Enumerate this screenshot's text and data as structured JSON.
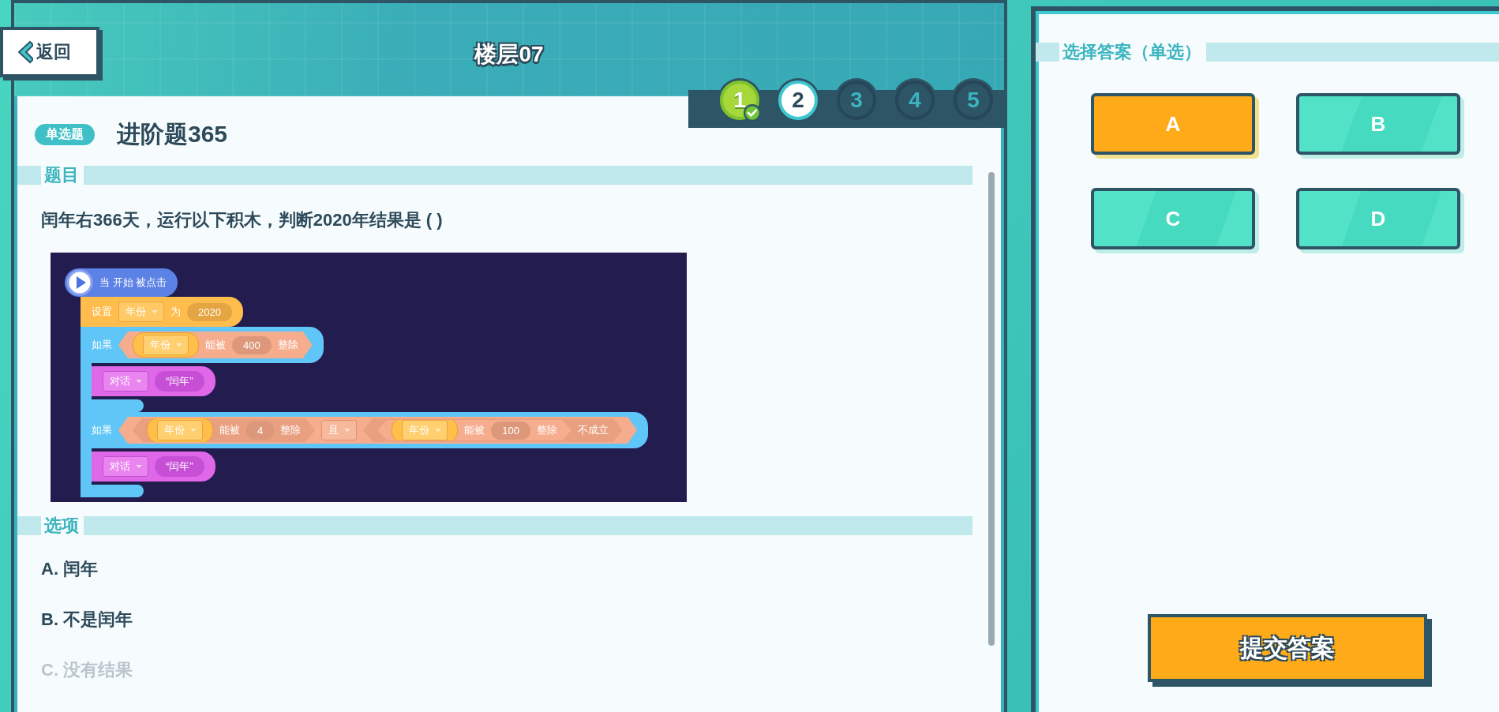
{
  "header": {
    "back_button": "返回",
    "title": "楼层07"
  },
  "question_steps": [
    {
      "label": "1",
      "done": true,
      "selected": false
    },
    {
      "label": "2",
      "done": false,
      "selected": true
    },
    {
      "label": "3",
      "done": false,
      "selected": false
    },
    {
      "label": "4",
      "done": false,
      "selected": false
    },
    {
      "label": "5",
      "done": false,
      "selected": false
    }
  ],
  "question": {
    "type_badge": "单选题",
    "title": "进阶题365",
    "stem_heading": "题目",
    "stem": "闰年右366天，运行以下积木，判断2020年结果是 ( )",
    "code_script": [
      {
        "kind": "event_hat",
        "parts": [
          {
            "kind": "text",
            "text": "当 开始 被点击"
          }
        ]
      },
      {
        "kind": "set_variable",
        "parts": [
          {
            "kind": "text",
            "text": "设置"
          },
          {
            "kind": "dropdown",
            "text": "年份"
          },
          {
            "kind": "text",
            "text": "为"
          },
          {
            "kind": "slot",
            "text": "2020"
          }
        ]
      },
      {
        "kind": "if",
        "parts": [
          {
            "kind": "text",
            "text": "如果"
          },
          {
            "kind": "condition",
            "parts": [
              {
                "kind": "reporter",
                "parts": [
                  {
                    "kind": "dropdown",
                    "text": "年份"
                  }
                ]
              },
              {
                "kind": "text",
                "text": "能被"
              },
              {
                "kind": "slot",
                "text": "400"
              },
              {
                "kind": "text",
                "text": "整除"
              }
            ]
          }
        ],
        "body": [
          {
            "kind": "say",
            "parts": [
              {
                "kind": "dropdown",
                "text": "对话"
              },
              {
                "kind": "slot",
                "text": "“闰年”"
              }
            ]
          }
        ]
      },
      {
        "kind": "if",
        "parts": [
          {
            "kind": "text",
            "text": "如果"
          },
          {
            "kind": "condition",
            "parts": [
              {
                "kind": "condition",
                "parts": [
                  {
                    "kind": "reporter",
                    "parts": [
                      {
                        "kind": "dropdown",
                        "text": "年份"
                      }
                    ]
                  },
                  {
                    "kind": "text",
                    "text": "能被"
                  },
                  {
                    "kind": "slot",
                    "text": "4"
                  },
                  {
                    "kind": "text",
                    "text": "整除"
                  }
                ]
              },
              {
                "kind": "dropdown",
                "text": "且"
              },
              {
                "kind": "condition",
                "parts": [
                  {
                    "kind": "condition",
                    "parts": [
                      {
                        "kind": "reporter",
                        "parts": [
                          {
                            "kind": "dropdown",
                            "text": "年份"
                          }
                        ]
                      },
                      {
                        "kind": "text",
                        "text": "能被"
                      },
                      {
                        "kind": "slot",
                        "text": "100"
                      },
                      {
                        "kind": "text",
                        "text": "整除"
                      }
                    ]
                  },
                  {
                    "kind": "text",
                    "text": "不成立"
                  }
                ]
              }
            ]
          }
        ],
        "body": [
          {
            "kind": "say",
            "parts": [
              {
                "kind": "dropdown",
                "text": "对话"
              },
              {
                "kind": "slot",
                "text": "“闰年”"
              }
            ]
          }
        ]
      }
    ],
    "options_heading": "选项",
    "options": [
      "A. 闰年",
      "B. 不是闰年",
      "C. 没有结果"
    ]
  },
  "answer_panel": {
    "heading": "选择答案（单选）",
    "choices": [
      {
        "label": "A",
        "selected": true
      },
      {
        "label": "B",
        "selected": false
      },
      {
        "label": "C",
        "selected": false
      },
      {
        "label": "D",
        "selected": false
      }
    ],
    "submit_button": "提交答案"
  }
}
